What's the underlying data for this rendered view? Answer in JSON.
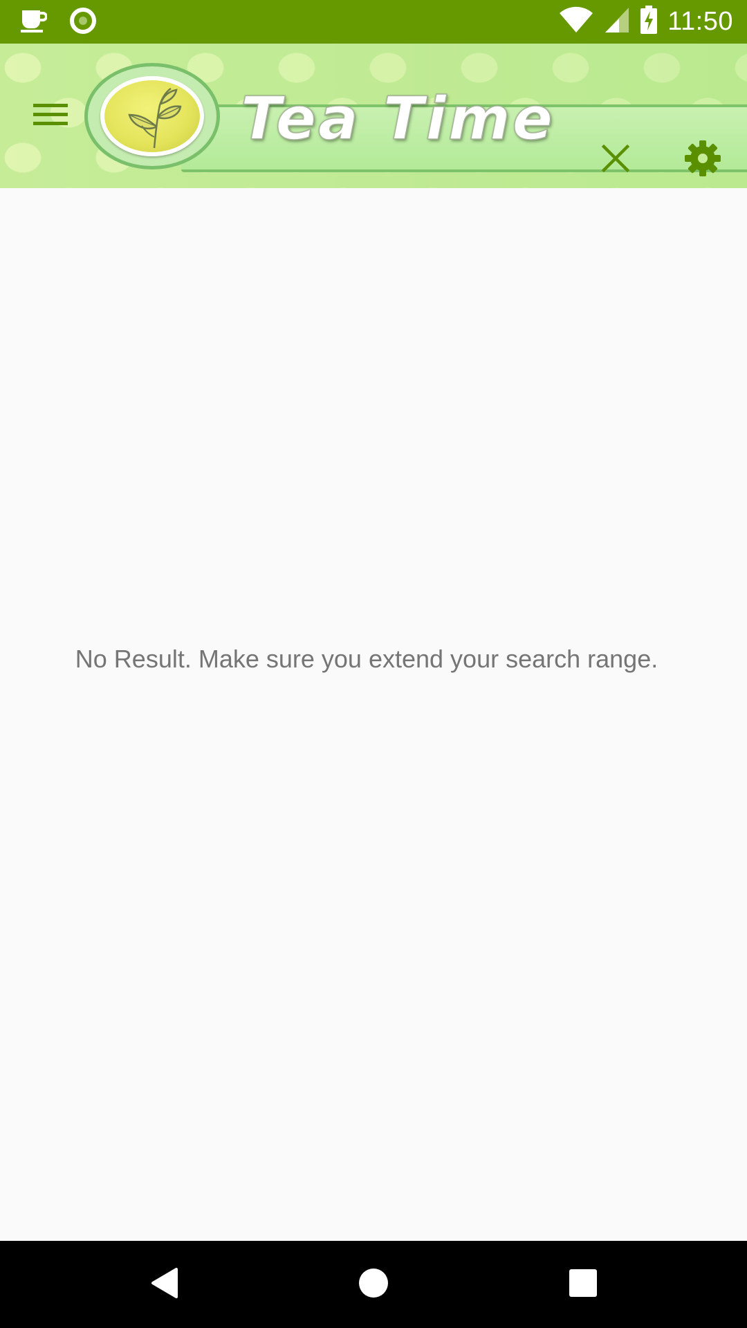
{
  "status_bar": {
    "time": "11:50",
    "left_icons": [
      "coffee-cup-icon",
      "circle-notification-icon"
    ],
    "right_icons": [
      "wifi-icon",
      "cell-signal-icon",
      "battery-charging-icon"
    ]
  },
  "app_bar": {
    "title": "Tea Time",
    "menu_icon": "hamburger-menu-icon",
    "close_icon": "close-icon",
    "settings_icon": "gear-icon",
    "logo_icon": "tea-leaf-logo-icon"
  },
  "content": {
    "empty_message": "No Result. Make sure you extend your search range."
  },
  "nav_bar": {
    "buttons": [
      "back-icon",
      "home-icon",
      "recents-icon"
    ]
  },
  "colors": {
    "status_bar": "#669900",
    "accent": "#669900",
    "app_bar_bg": "#c6ec98",
    "message_text": "#757575",
    "content_bg": "#fafafa"
  }
}
